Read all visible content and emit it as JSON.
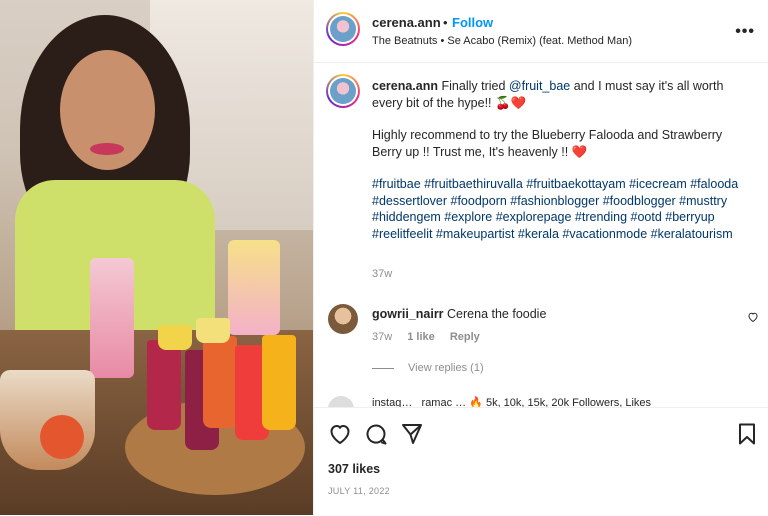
{
  "post": {
    "username": "cerena.ann",
    "follow_label": "Follow",
    "separator": "•",
    "audio": "The Beatnuts • Se Acabo (Remix) (feat. Method Man)",
    "more_label": "•••"
  },
  "caption": {
    "username": "cerena.ann",
    "line1_pre": "Finally tried",
    "mention": "@fruit_bae",
    "line1_post": "and I must say it's all worth every bit of the hype!! 🍒❤️",
    "para2": "Highly recommend to try the Blueberry Falooda and Strawberry Berry up !! Trust me, It's heavenly !! ❤️",
    "hashtags": "#fruitbae #fruitbaethiruvalla #fruitbaekottayam #icecream #falooda #dessertlover #foodporn #fashionblogger #foodblogger #musttry #hiddengem #explore #explorepage #trending #ootd #berryup #reelitfeelit #makeupartist #kerala #vacationmode #keralatourism",
    "time": "37w"
  },
  "comment": {
    "username": "gowrii_nairr",
    "text": "Cerena the foodie",
    "time": "37w",
    "likes": "1 like",
    "reply_label": "Reply",
    "view_replies": "View replies (1)"
  },
  "cut_comment": {
    "text": "instag… _ramac … 🔥 5k, 10k, 15k, 20k Followers, Likes"
  },
  "footer": {
    "likes": "307 likes",
    "date": "JULY 11, 2022"
  },
  "icons": [
    "heart-icon",
    "comment-icon",
    "share-icon",
    "bookmark-icon",
    "more-icon"
  ],
  "colors": {
    "link": "#0095f6",
    "tag": "#00376b",
    "muted": "#8e8e8e"
  }
}
